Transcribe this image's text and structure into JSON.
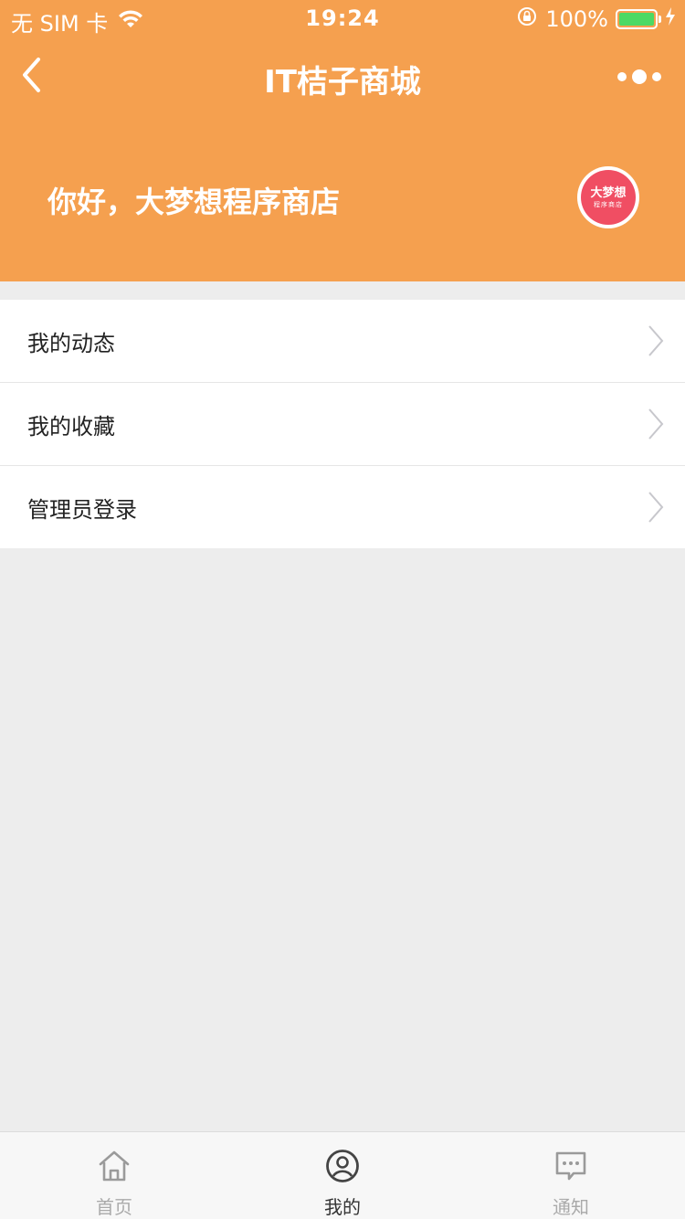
{
  "status_bar": {
    "carrier": "无 SIM 卡",
    "time": "19:24",
    "battery_percent": "100%",
    "battery_level": 1.0
  },
  "nav": {
    "title": "IT桔子商城",
    "back_icon": "chevron-left-icon",
    "more_icon": "more-dots-icon"
  },
  "profile": {
    "greeting": "你好，大梦想程序商店",
    "avatar_line1": "大梦想",
    "avatar_line2": "程序商店"
  },
  "menu": {
    "items": [
      {
        "label": "我的动态"
      },
      {
        "label": "我的收藏"
      },
      {
        "label": "管理员登录"
      }
    ]
  },
  "tab_bar": {
    "tabs": [
      {
        "label": "首页",
        "icon": "home-icon",
        "active": false
      },
      {
        "label": "我的",
        "icon": "user-icon",
        "active": true
      },
      {
        "label": "通知",
        "icon": "message-icon",
        "active": false
      }
    ]
  },
  "colors": {
    "header_bg": "#f5a04f",
    "avatar_bg": "#f04e63",
    "page_bg": "#ededed",
    "battery_fill": "#4cd964"
  }
}
